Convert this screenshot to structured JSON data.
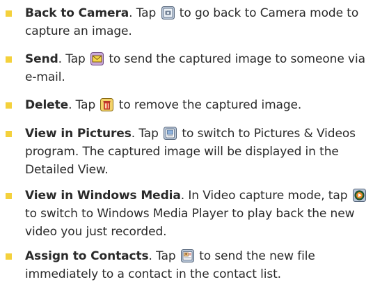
{
  "items": [
    {
      "term": "Back to Camera",
      "pre": ". Tap ",
      "post": " to go back to Camera mode to",
      "line2": "capture an image.",
      "icon": "camera-icon"
    },
    {
      "term": "Send",
      "pre": ". Tap ",
      "post": " to send the captured image to someone via",
      "line2": "e-mail.",
      "icon": "envelope-icon"
    },
    {
      "term": "Delete",
      "pre": ". Tap ",
      "post": " to remove the captured image.",
      "icon": "trash-icon"
    },
    {
      "term": "View in Pictures",
      "pre": ". Tap ",
      "post": " to switch to Pictures & Videos",
      "line2": "program. The captured image will be displayed in the",
      "line3": "Detailed View.",
      "icon": "pictures-icon"
    },
    {
      "term": "View in Windows Media",
      "pre": ". In Video capture mode, tap ",
      "post": "",
      "line2": "to switch to Windows Media Player to play back the new",
      "line3": "video you just recorded.",
      "icon": "media-player-icon"
    },
    {
      "term": "Assign to Contacts",
      "pre": ". Tap ",
      "post": " to send the new file",
      "line2": "immediately to a contact in the contact list.",
      "icon": "contacts-icon"
    }
  ]
}
